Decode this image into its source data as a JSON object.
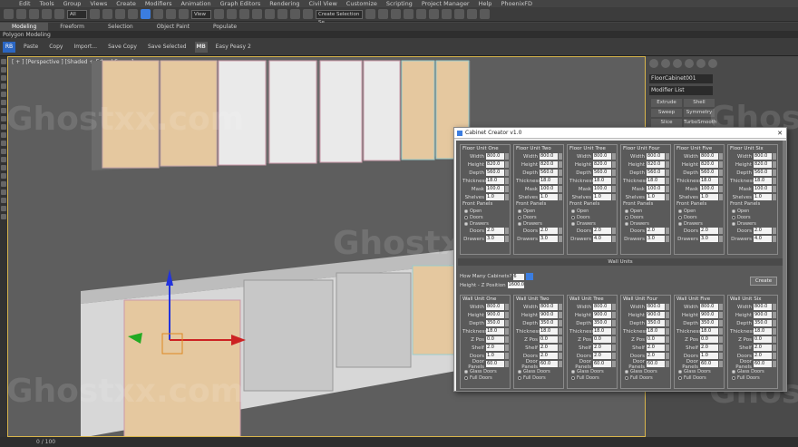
{
  "menu": [
    "Edit",
    "Tools",
    "Group",
    "Views",
    "Create",
    "Modifiers",
    "Animation",
    "Graph Editors",
    "Rendering",
    "Civil View",
    "Customize",
    "Scripting",
    "Project Manager",
    "Help",
    "PhoenixFD"
  ],
  "toolbar": {
    "filter": "All",
    "view": "View",
    "selset": "Create Selection Se"
  },
  "ribbon_tabs": [
    "Modeling",
    "Freeform",
    "Selection",
    "Object Paint",
    "Populate"
  ],
  "poly_modeling": "Polygon Modeling",
  "ribbon2": {
    "paste": "Paste",
    "copy": "Copy",
    "import": "Import...",
    "save_copy": "Save Copy",
    "save_selected": "Save Selected",
    "mb": "MB",
    "easy": "Easy Peasy 2"
  },
  "viewport_label": "[ + ] [Perspective ] [Shaded + Edged Faces ]",
  "status": "0 / 100",
  "cmd": {
    "object_name": "FloorCabinet001",
    "modifier_list": "Modifier List",
    "mods": [
      "Extrude",
      "Shell",
      "Sweep",
      "Symmetry",
      "Slice",
      "TurboSmooth"
    ]
  },
  "dialog": {
    "title": "Cabinet Creator v1.0",
    "floor_units": [
      {
        "title": "Floor Unit One",
        "width": "800.0",
        "height": "820.0",
        "depth": "560.0",
        "thickness": "18.0",
        "mask": "100.0",
        "shelves": "1.0",
        "doors": "2.0",
        "drawers": "3.0"
      },
      {
        "title": "Floor Unit Two",
        "width": "800.0",
        "height": "820.0",
        "depth": "560.0",
        "thickness": "18.0",
        "mask": "100.0",
        "shelves": "1.0",
        "doors": "2.0",
        "drawers": "3.0"
      },
      {
        "title": "Floor Unit Tree",
        "width": "800.0",
        "height": "820.0",
        "depth": "560.0",
        "thickness": "18.0",
        "mask": "100.0",
        "shelves": "1.0",
        "doors": "2.0",
        "drawers": "4.0"
      },
      {
        "title": "Floor Unit Four",
        "width": "800.0",
        "height": "820.0",
        "depth": "560.0",
        "thickness": "18.0",
        "mask": "100.0",
        "shelves": "1.0",
        "doors": "2.0",
        "drawers": "3.0"
      },
      {
        "title": "Floor Unit Five",
        "width": "800.0",
        "height": "820.0",
        "depth": "560.0",
        "thickness": "18.0",
        "mask": "100.0",
        "shelves": "1.0",
        "doors": "2.0",
        "drawers": "3.0"
      },
      {
        "title": "Floor Unit Six",
        "width": "800.0",
        "height": "820.0",
        "depth": "560.0",
        "thickness": "18.0",
        "mask": "100.0",
        "shelves": "1.0",
        "doors": "2.0",
        "drawers": "4.0"
      }
    ],
    "labels": {
      "width": "Width",
      "height": "Height",
      "depth": "Depth",
      "thickness": "Thickness",
      "mask": "Mask",
      "shelves": "Shelves",
      "front_panels": "Front Panels",
      "open": "Open",
      "doors": "Doors",
      "drawers": "Drawers",
      "v": "V",
      "h": "H",
      "zpos": "Z Pos",
      "shelf": "Shelf",
      "door_panels": "Door Panels",
      "glass": "Glass Doors",
      "full": "Full Doors"
    },
    "wall_rollout": "Wall Units",
    "how_many_label": "How Many Cabinets?",
    "how_many": "6",
    "height_label": "Height - Z Position",
    "height_val": "1600.0",
    "create": "Create",
    "wall_units": [
      {
        "title": "Wall Unit One",
        "width": "800.0",
        "height": "900.0",
        "depth": "350.0",
        "thickness": "18.0",
        "zpos": "0.0",
        "shelf": "2.0",
        "doors": "1.0",
        "panels": "60.0"
      },
      {
        "title": "Wall Unit Two",
        "width": "800.0",
        "height": "900.0",
        "depth": "350.0",
        "thickness": "18.0",
        "zpos": "0.0",
        "shelf": "2.0",
        "doors": "2.0",
        "panels": "60.0"
      },
      {
        "title": "Wall Unit Tree",
        "width": "800.0",
        "height": "900.0",
        "depth": "350.0",
        "thickness": "18.0",
        "zpos": "0.0",
        "shelf": "2.0",
        "doors": "2.0",
        "panels": "60.0"
      },
      {
        "title": "Wall Unit Four",
        "width": "800.0",
        "height": "900.0",
        "depth": "350.0",
        "thickness": "18.0",
        "zpos": "0.0",
        "shelf": "2.0",
        "doors": "2.0",
        "panels": "60.0"
      },
      {
        "title": "Wall Unit Five",
        "width": "800.0",
        "height": "900.0",
        "depth": "350.0",
        "thickness": "18.0",
        "zpos": "0.0",
        "shelf": "2.0",
        "doors": "1.0",
        "panels": "60.0"
      },
      {
        "title": "Wall Unit Six",
        "width": "800.0",
        "height": "900.0",
        "depth": "350.0",
        "thickness": "18.0",
        "zpos": "0.0",
        "shelf": "2.0",
        "doors": "2.0",
        "panels": "60.0"
      }
    ]
  },
  "watermark": "Ghostxx.com"
}
